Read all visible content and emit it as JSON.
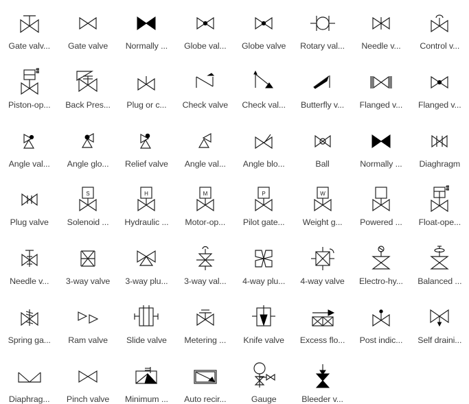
{
  "palette": {
    "columns": 8,
    "rows": 6,
    "background_color": "#ffffff",
    "symbol_color": "#1a1a1a",
    "label_color": "#3b3b3b",
    "items": [
      {
        "label": "Gate valv...",
        "icon": "gate-valve-handwheel-icon"
      },
      {
        "label": "Gate valve",
        "icon": "gate-valve-icon"
      },
      {
        "label": "Normally ...",
        "icon": "normally-closed-valve-icon"
      },
      {
        "label": "Globe val...",
        "icon": "globe-valve-icon"
      },
      {
        "label": "Globe valve",
        "icon": "globe-valve-filled-icon"
      },
      {
        "label": "Rotary val...",
        "icon": "rotary-valve-icon"
      },
      {
        "label": "Needle v...",
        "icon": "needle-valve-icon"
      },
      {
        "label": "Control v...",
        "icon": "control-valve-icon"
      },
      {
        "label": "Piston-op...",
        "icon": "piston-operated-valve-icon"
      },
      {
        "label": "Back Pres...",
        "icon": "back-pressure-valve-icon"
      },
      {
        "label": "Plug or c...",
        "icon": "plug-or-cock-valve-icon"
      },
      {
        "label": "Check valve",
        "icon": "check-valve-icon"
      },
      {
        "label": "Check val...",
        "icon": "check-valve-angle-icon"
      },
      {
        "label": "Butterfly v...",
        "icon": "butterfly-valve-icon"
      },
      {
        "label": "Flanged v...",
        "icon": "flanged-valve-icon"
      },
      {
        "label": "Flanged v...",
        "icon": "flanged-globe-valve-icon"
      },
      {
        "label": "Angle val...",
        "icon": "angle-valve-icon"
      },
      {
        "label": "Angle glo...",
        "icon": "angle-globe-valve-icon"
      },
      {
        "label": "Relief valve",
        "icon": "relief-valve-icon"
      },
      {
        "label": "Angle val...",
        "icon": "angle-valve-plain-icon"
      },
      {
        "label": "Angle blo...",
        "icon": "angle-blowdown-valve-icon"
      },
      {
        "label": "Ball",
        "icon": "ball-valve-icon"
      },
      {
        "label": "Normally ...",
        "icon": "normally-closed-ball-icon"
      },
      {
        "label": "Diaghragm",
        "icon": "diaphragm-valve-icon"
      },
      {
        "label": "Plug valve",
        "icon": "plug-valve-icon"
      },
      {
        "label": "Solenoid ...",
        "icon": "solenoid-valve-icon"
      },
      {
        "label": "Hydraulic ...",
        "icon": "hydraulic-valve-icon"
      },
      {
        "label": "Motor-op...",
        "icon": "motor-operated-valve-icon"
      },
      {
        "label": "Pilot gate...",
        "icon": "pilot-gate-valve-icon"
      },
      {
        "label": "Weight g...",
        "icon": "weight-gate-valve-icon"
      },
      {
        "label": "Powered ...",
        "icon": "powered-valve-icon"
      },
      {
        "label": "Float-ope...",
        "icon": "float-operated-valve-icon"
      },
      {
        "label": "Needle v...",
        "icon": "needle-valve-stem-icon"
      },
      {
        "label": "3-way valve",
        "icon": "three-way-valve-icon"
      },
      {
        "label": "3-way plu...",
        "icon": "three-way-plug-valve-icon"
      },
      {
        "label": "3-way val...",
        "icon": "three-way-valve-actuated-icon"
      },
      {
        "label": "4-way plu...",
        "icon": "four-way-plug-valve-icon"
      },
      {
        "label": "4-way valve",
        "icon": "four-way-valve-icon"
      },
      {
        "label": "Electro-hy...",
        "icon": "electro-hydraulic-valve-icon"
      },
      {
        "label": "Balanced ...",
        "icon": "balanced-valve-icon"
      },
      {
        "label": "Spring ga...",
        "icon": "spring-gate-valve-icon"
      },
      {
        "label": "Ram valve",
        "icon": "ram-valve-icon"
      },
      {
        "label": "Slide valve",
        "icon": "slide-valve-icon"
      },
      {
        "label": "Metering ...",
        "icon": "metering-valve-icon"
      },
      {
        "label": "Knife valve",
        "icon": "knife-valve-icon"
      },
      {
        "label": "Excess flo...",
        "icon": "excess-flow-valve-icon"
      },
      {
        "label": "Post indic...",
        "icon": "post-indicator-valve-icon"
      },
      {
        "label": "Self draini...",
        "icon": "self-draining-valve-icon"
      },
      {
        "label": "Diaphrag...",
        "icon": "diaphragm-operated-valve-icon"
      },
      {
        "label": "Pinch valve",
        "icon": "pinch-valve-icon"
      },
      {
        "label": "Minimum ...",
        "icon": "minimum-flow-valve-icon"
      },
      {
        "label": "Auto recir...",
        "icon": "auto-recirculation-valve-icon"
      },
      {
        "label": "Gauge",
        "icon": "gauge-icon"
      },
      {
        "label": "Bleeder v...",
        "icon": "bleeder-valve-icon"
      }
    ],
    "actuator_letters": {
      "solenoid": "S",
      "hydraulic": "H",
      "motor": "M",
      "pilot": "P",
      "weight": "W"
    }
  }
}
